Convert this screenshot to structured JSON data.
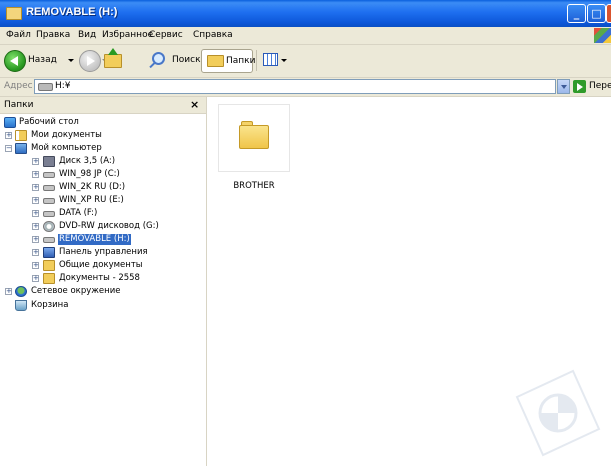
{
  "window": {
    "title": "REMOVABLE (H:)"
  },
  "menu": [
    "Файл",
    "Правка",
    "Вид",
    "Избранное",
    "Сервис",
    "Справка"
  ],
  "toolbar": {
    "back_label": "Назад",
    "search_label": "Поиск",
    "folders_label": "Папки"
  },
  "address": {
    "label": "Адрес",
    "value": "H:¥",
    "go_label": "Переход"
  },
  "folders_pane": {
    "title": "Папки",
    "close": "×",
    "tree": [
      {
        "label": "Рабочий стол",
        "icon": "desktop-icon"
      },
      {
        "label": "Мои документы",
        "icon": "my-documents-icon",
        "expander": "+"
      },
      {
        "label": "Мой компьютер",
        "icon": "my-computer-icon",
        "expander": "−"
      },
      {
        "label": "Диск 3,5 (A:)",
        "icon": "floppy-drive-icon",
        "expander": "+"
      },
      {
        "label": "WIN_98 JP (C:)",
        "icon": "hard-drive-icon",
        "expander": "+"
      },
      {
        "label": "WIN_2K RU (D:)",
        "icon": "hard-drive-icon",
        "expander": "+"
      },
      {
        "label": "WIN_XP RU (E:)",
        "icon": "hard-drive-icon",
        "expander": "+"
      },
      {
        "label": "DATA (F:)",
        "icon": "hard-drive-icon",
        "expander": "+"
      },
      {
        "label": "DVD-RW дисковод (G:)",
        "icon": "dvd-drive-icon",
        "expander": "+"
      },
      {
        "label": "REMOVABLE (H:)",
        "icon": "removable-drive-icon",
        "expander": "+",
        "selected": true
      },
      {
        "label": "Панель управления",
        "icon": "control-panel-icon",
        "expander": "+"
      },
      {
        "label": "Общие документы",
        "icon": "shared-documents-icon",
        "expander": "+"
      },
      {
        "label": "Документы - 2558",
        "icon": "user-documents-icon",
        "expander": "+"
      },
      {
        "label": "Сетевое окружение",
        "icon": "network-places-icon",
        "expander": "+"
      },
      {
        "label": "Корзина",
        "icon": "recycle-bin-icon"
      }
    ]
  },
  "content": {
    "items": [
      {
        "name": "BROTHER",
        "icon": "folder-icon"
      }
    ]
  },
  "colors": {
    "titlebar": "#0c56d8",
    "selection": "#316ac5",
    "chrome": "#ece9d8"
  }
}
